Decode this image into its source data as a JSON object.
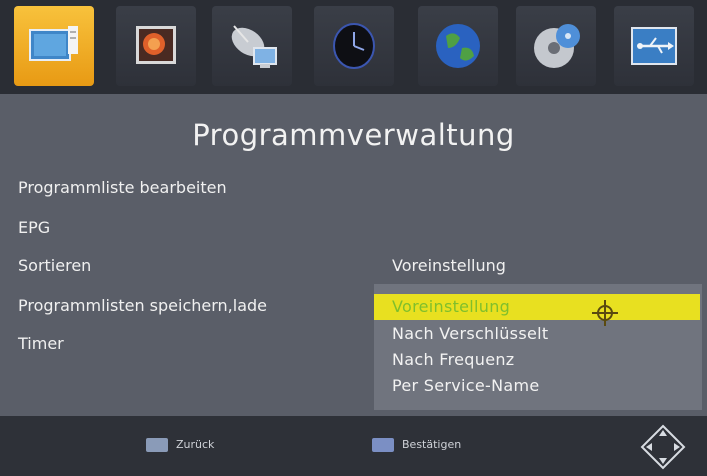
{
  "icon_bar": {
    "items": [
      {
        "icon": "tv-program-icon",
        "selected": true
      },
      {
        "icon": "picture-icon",
        "selected": false
      },
      {
        "icon": "satellite-dish-icon",
        "selected": false
      },
      {
        "icon": "clock-icon",
        "selected": false
      },
      {
        "icon": "globe-icon",
        "selected": false
      },
      {
        "icon": "disc-icon",
        "selected": false
      },
      {
        "icon": "usb-icon",
        "selected": false
      }
    ]
  },
  "page": {
    "title": "Programmverwaltung"
  },
  "menu": {
    "items": [
      {
        "label": "Programmliste bearbeiten"
      },
      {
        "label": "EPG"
      },
      {
        "label": "Sortieren"
      },
      {
        "label": "Programmlisten speichern,lade"
      },
      {
        "label": "Timer"
      }
    ],
    "sort_value": "Voreinstellung"
  },
  "dropdown": {
    "options": [
      {
        "label": "Voreinstellung",
        "highlighted": true
      },
      {
        "label": "Nach Verschlüsselt",
        "highlighted": false
      },
      {
        "label": "Nach Frequenz",
        "highlighted": false
      },
      {
        "label": "Per Service-Name",
        "highlighted": false
      }
    ]
  },
  "footer": {
    "back_label": "Zurück",
    "confirm_label": "Bestätigen"
  },
  "colors": {
    "selected_tile": "#f0a820",
    "highlight": "#e8e020",
    "highlight_text": "#7fbf2c"
  }
}
